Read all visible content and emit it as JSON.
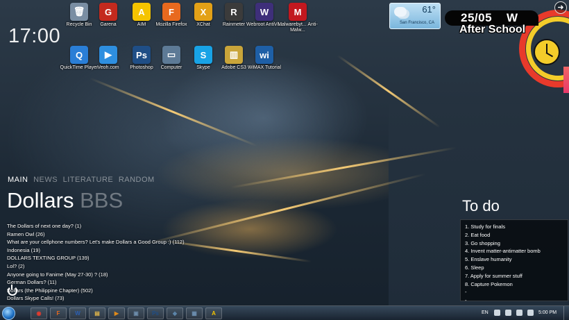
{
  "desktop": {
    "icons": [
      {
        "label": "Recycle Bin",
        "icon": "recycle-bin-icon",
        "glyph": "🗑",
        "color": "#7a8ea3"
      },
      {
        "label": "Garena",
        "icon": "garena-icon",
        "glyph": "G",
        "color": "#c42a1e"
      },
      {
        "label": "AIM",
        "icon": "aim-icon",
        "glyph": "A",
        "color": "#f5c400"
      },
      {
        "label": "Mozilla Firefox",
        "icon": "firefox-icon",
        "glyph": "F",
        "color": "#e8691e"
      },
      {
        "label": "XChat",
        "icon": "xchat-icon",
        "glyph": "X",
        "color": "#e3a117"
      },
      {
        "label": "Rainmeter",
        "icon": "rainmeter-icon",
        "glyph": "R",
        "color": "#3b3b3b"
      },
      {
        "label": "Webroot AntiVi...",
        "icon": "webroot-icon",
        "glyph": "W",
        "color": "#3e2f7a"
      },
      {
        "label": "Malwarebyt... Anti-Malw...",
        "icon": "malwarebytes-icon",
        "glyph": "M",
        "color": "#c2181f"
      },
      {
        "label": "QuickTime Player",
        "icon": "quicktime-icon",
        "glyph": "Q",
        "color": "#2a7ed6"
      },
      {
        "label": "Veoh.com",
        "icon": "veoh-icon",
        "glyph": "▶",
        "color": "#2e8fe0"
      },
      {
        "label": "Photoshop",
        "icon": "photoshop-icon",
        "glyph": "Ps",
        "color": "#1f4e86"
      },
      {
        "label": "Computer",
        "icon": "computer-icon",
        "glyph": "▭",
        "color": "#5d7a96"
      },
      {
        "label": "Skype",
        "icon": "skype-icon",
        "glyph": "S",
        "color": "#18a3e6"
      },
      {
        "label": "Adobe CS3",
        "icon": "adobe-cs3-icon",
        "glyph": "▥",
        "color": "#c9a53a"
      },
      {
        "label": "WiMAX Tutorial",
        "icon": "wimax-icon",
        "glyph": "wi",
        "color": "#1e5fa6"
      }
    ]
  },
  "clock_left": "17:00",
  "weather": {
    "temp": "61°",
    "city": "San Francisco, CA"
  },
  "date_widget": {
    "date": "25/05",
    "day": "W",
    "tagline": "After School"
  },
  "feed": {
    "tabs": [
      "MAIN",
      "NEWS",
      "LITERATURE",
      "RANDOM"
    ],
    "title_a": "Dollars",
    "title_b": "BBS",
    "items": [
      "The Dollars of next one day? (1)",
      "Ramen Owl (26)",
      "What are your cellphone numbers? Let's make Dollars a Good Group :) (112)",
      "Indonesia (19)",
      "DOLLARS TEXTING GROUP (139)",
      "Lol? (2)",
      "Anyone going to Fanime (May 27-30) ? (18)",
      "German Dollars? (11)",
      "Dollars (the Philippine Chapter) (502)",
      "Dollars Skype Calls! (73)"
    ]
  },
  "todo": {
    "title": "To do",
    "items": [
      "1. Study for finals",
      "2. Eat food",
      "3. Go shopping",
      "4. Invent matter-antimatter bomb",
      "5. Enslave humanity",
      "6. Sleep",
      "7. Apply for summer stuff",
      "8. Capture Pokemon",
      "-",
      "-"
    ]
  },
  "taskbar": {
    "buttons": [
      {
        "icon": "chrome-icon",
        "glyph": "◉",
        "color": "#e33b2e"
      },
      {
        "icon": "firefox-icon",
        "glyph": "F",
        "color": "#e8691e"
      },
      {
        "icon": "word-icon",
        "glyph": "W",
        "color": "#2b5fb4"
      },
      {
        "icon": "folder-icon",
        "glyph": "▤",
        "color": "#e2b74a"
      },
      {
        "icon": "media-player-icon",
        "glyph": "▶",
        "color": "#e08a1a"
      },
      {
        "icon": "photo-viewer-icon",
        "glyph": "▣",
        "color": "#6b8aa8"
      },
      {
        "icon": "photoshop-icon",
        "glyph": "Ps",
        "color": "#1f4e86"
      },
      {
        "icon": "droplet-icon",
        "glyph": "◆",
        "color": "#5c84a8"
      },
      {
        "icon": "notepad-icon",
        "glyph": "▦",
        "color": "#6d8fb0"
      },
      {
        "icon": "aim-icon",
        "glyph": "A",
        "color": "#f5c400"
      }
    ],
    "language": "EN",
    "time": "5:00 PM"
  }
}
